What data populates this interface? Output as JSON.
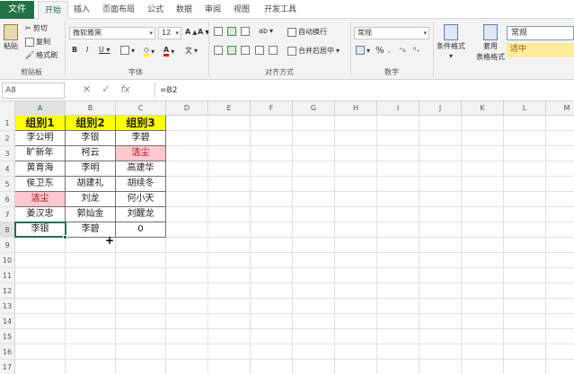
{
  "menu": {
    "file": "文件",
    "tabs": [
      "开始",
      "插入",
      "页面布局",
      "公式",
      "数据",
      "审阅",
      "视图",
      "开发工具"
    ]
  },
  "ribbon": {
    "clipboard": {
      "paste": "粘贴",
      "cut": "剪切",
      "copy": "复制",
      "format_painter": "格式刷",
      "label": "剪贴板"
    },
    "font": {
      "name": "微软雅黑",
      "size": "12",
      "label": "字体"
    },
    "alignment": {
      "wrap": "自动换行",
      "merge": "合并后居中",
      "label": "对齐方式"
    },
    "number": {
      "format": "常规",
      "percent": "%",
      "label": "数字"
    },
    "styles": {
      "conditional": "条件格式",
      "table_line1": "套用",
      "table_line2": "表格格式",
      "normal": "常规",
      "good": "适中"
    }
  },
  "formula_bar": {
    "name_box": "A8",
    "formula": "=B2"
  },
  "columns": [
    "A",
    "B",
    "C",
    "D",
    "E",
    "F",
    "G",
    "H",
    "I",
    "J",
    "K",
    "L",
    "M"
  ],
  "rows": [
    "1",
    "2",
    "3",
    "4",
    "5",
    "6",
    "7",
    "8",
    "9",
    "10",
    "11",
    "12",
    "13",
    "14",
    "15",
    "16",
    "17"
  ],
  "table": {
    "headers": [
      "组别1",
      "组别2",
      "组别3"
    ],
    "data": [
      [
        "李公明",
        "李银",
        "李碧"
      ],
      [
        "旷新年",
        "柯云",
        "洁尘"
      ],
      [
        "黄育海",
        "李明",
        "高建华"
      ],
      [
        "侯卫东",
        "胡建礼",
        "胡续冬"
      ],
      [
        "洁尘",
        "刘龙",
        "何小天"
      ],
      [
        "姜汉忠",
        "郭灿金",
        "刘醒龙"
      ],
      [
        "李银",
        "李碧",
        "0"
      ]
    ]
  },
  "colors": {
    "accent": "#217346",
    "header_fill": "#ffff00",
    "duplicate_fill": "#ffc7ce",
    "duplicate_text": "#9c0006"
  }
}
